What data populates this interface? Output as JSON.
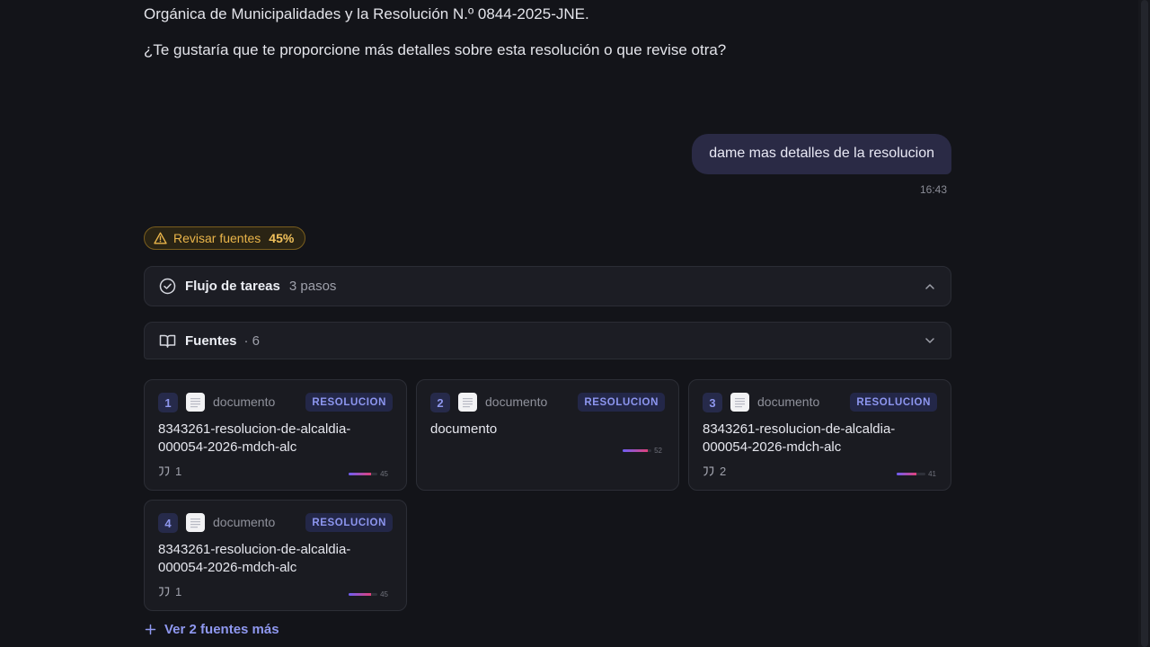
{
  "conversation": {
    "assistant_paragraph_1": "Orgánica de Municipalidades y la Resolución N.º 0844-2025-JNE.",
    "assistant_paragraph_2": "¿Te gustaría que te proporcione más detalles sobre esta resolución o que revise otra?",
    "user_message": "dame mas detalles de la resolucion",
    "user_timestamp": "16:43"
  },
  "review_badge": {
    "label": "Revisar fuentes",
    "percent": "45%",
    "color": "#eab54a"
  },
  "tasks_panel": {
    "title": "Flujo de tareas",
    "steps": "3 pasos",
    "icon": "check-circle-icon",
    "state": "expanded"
  },
  "sources_panel": {
    "title": "Fuentes",
    "count": "· 6",
    "icon": "book-open-icon",
    "state": "collapsed"
  },
  "source_cards": [
    {
      "index": "1",
      "type_label": "documento",
      "tag": "RESOLUCION",
      "title": "8343261-resolucion-de-alcaldia-000054-2026-mdch-alc",
      "citations": "1",
      "score": "45",
      "score_fraction": 0.45
    },
    {
      "index": "2",
      "type_label": "documento",
      "tag": "RESOLUCION",
      "title": "documento",
      "citations": "",
      "score": "52",
      "score_fraction": 0.52
    },
    {
      "index": "3",
      "type_label": "documento",
      "tag": "RESOLUCION",
      "title": "8343261-resolucion-de-alcaldia-000054-2026-mdch-alc",
      "citations": "2",
      "score": "41",
      "score_fraction": 0.41
    },
    {
      "index": "4",
      "type_label": "documento",
      "tag": "RESOLUCION",
      "title": "8343261-resolucion-de-alcaldia-000054-2026-mdch-alc",
      "citations": "1",
      "score": "45",
      "score_fraction": 0.45
    }
  ],
  "more_sources": {
    "label": "Ver 2 fuentes más",
    "icon": "plus-icon"
  },
  "colors": {
    "accent": "#8d96f0",
    "user_bubble": "#2a2a45",
    "background": "#131419",
    "warning": "#eab54a"
  }
}
